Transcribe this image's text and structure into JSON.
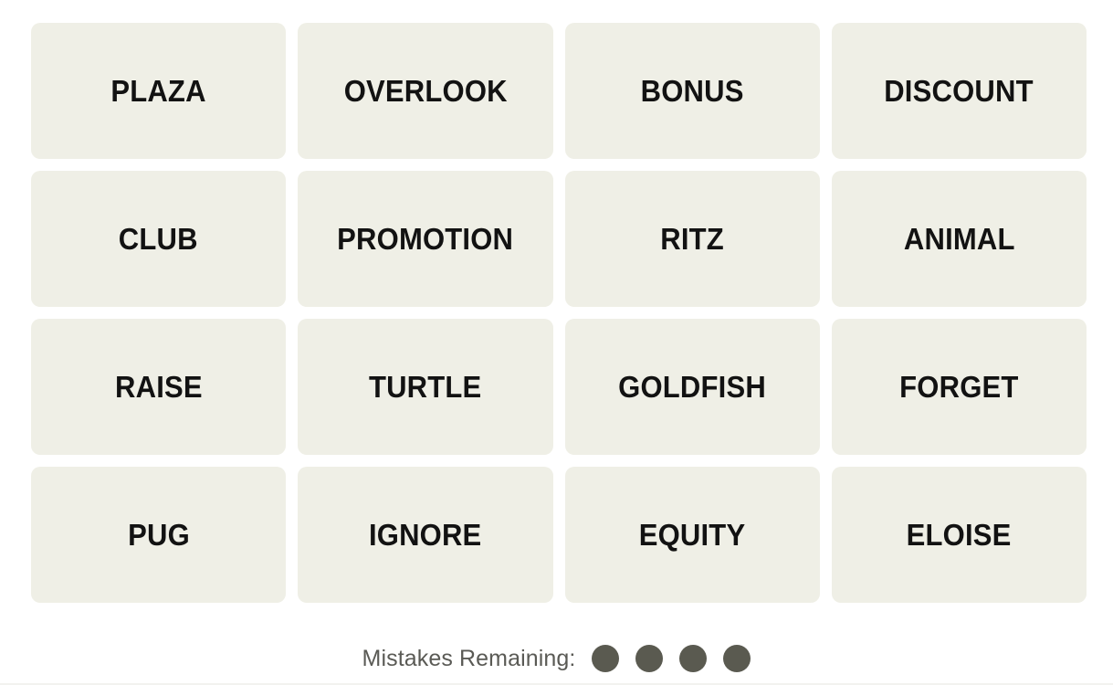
{
  "game": {
    "name": "Connections",
    "tile_color": "#EFEFE6",
    "tile_text_color": "#121212",
    "background_color": "#FFFFFF"
  },
  "grid": {
    "columns": 4,
    "rows": 4,
    "tiles": [
      {
        "word": "PLAZA"
      },
      {
        "word": "OVERLOOK"
      },
      {
        "word": "BONUS"
      },
      {
        "word": "DISCOUNT"
      },
      {
        "word": "CLUB"
      },
      {
        "word": "PROMOTION"
      },
      {
        "word": "RITZ"
      },
      {
        "word": "ANIMAL"
      },
      {
        "word": "RAISE"
      },
      {
        "word": "TURTLE"
      },
      {
        "word": "GOLDFISH"
      },
      {
        "word": "FORGET"
      },
      {
        "word": "PUG"
      },
      {
        "word": "IGNORE"
      },
      {
        "word": "EQUITY"
      },
      {
        "word": "ELOISE"
      }
    ]
  },
  "mistakes": {
    "label": "Mistakes Remaining:",
    "remaining": 4,
    "dot_color": "#5A5A50",
    "label_color": "#5A5A55",
    "dots": [
      {
        "state": "remaining"
      },
      {
        "state": "remaining"
      },
      {
        "state": "remaining"
      },
      {
        "state": "remaining"
      }
    ]
  }
}
